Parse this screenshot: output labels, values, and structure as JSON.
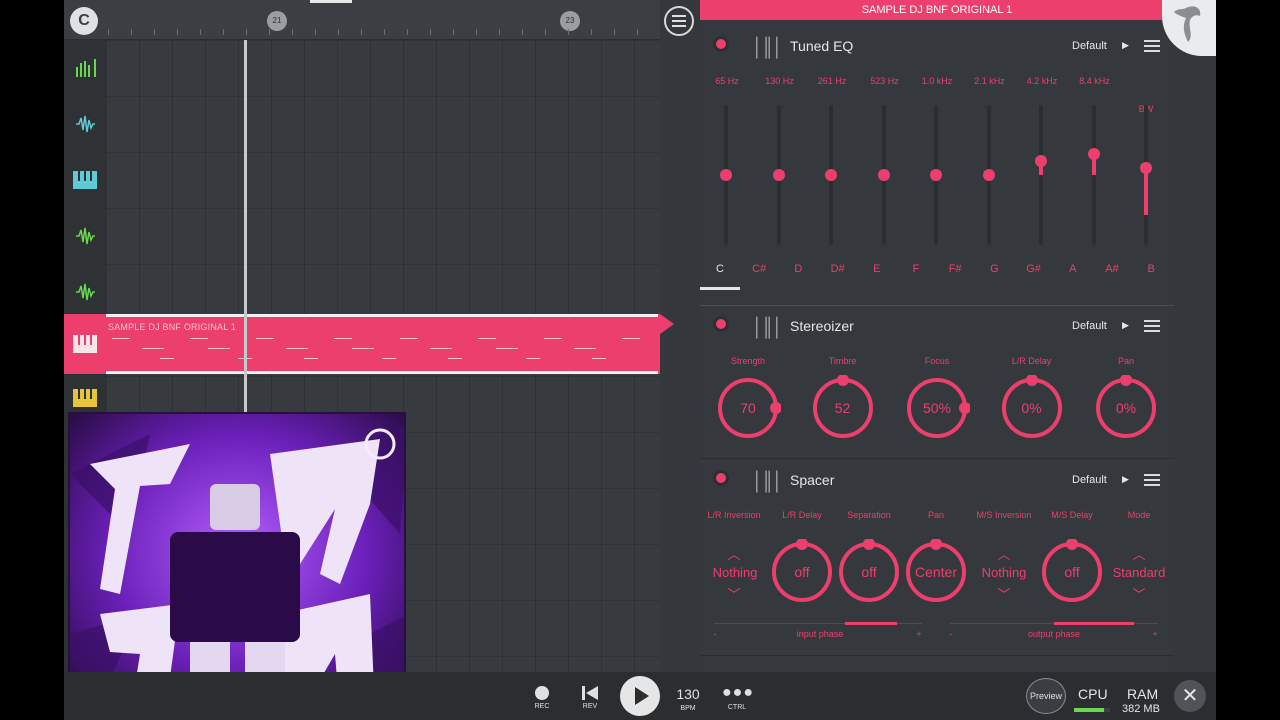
{
  "ruler": {
    "markers": [
      "21",
      "23"
    ]
  },
  "logo": "C",
  "clip": {
    "name": "SAMPLE DJ BNF ORIGINAL 1"
  },
  "mixer": {
    "channel_title": "SAMPLE DJ BNF ORIGINAL 1"
  },
  "tuned_eq": {
    "title": "Tuned EQ",
    "preset": "Default",
    "freqs": [
      "65 Hz",
      "130 Hz",
      "261 Hz",
      "523 Hz",
      "1.0 kHz",
      "2.1 kHz",
      "4.2 kHz",
      "8.4 kHz"
    ],
    "bw_label": "BW",
    "band_levels": [
      0.5,
      0.5,
      0.5,
      0.5,
      0.5,
      0.5,
      0.6,
      0.65,
      0.55
    ],
    "notes": [
      "C",
      "C#",
      "D",
      "D#",
      "E",
      "F",
      "F#",
      "G",
      "G#",
      "A",
      "A#",
      "B"
    ],
    "selected_note": "C"
  },
  "stereoizer": {
    "title": "Stereoizer",
    "preset": "Default",
    "knobs": [
      {
        "label": "Strength",
        "value": "70"
      },
      {
        "label": "Timbre",
        "value": "52"
      },
      {
        "label": "Focus",
        "value": "50%"
      },
      {
        "label": "L/R Delay",
        "value": "0%"
      },
      {
        "label": "Pan",
        "value": "0%"
      }
    ]
  },
  "spacer": {
    "title": "Spacer",
    "preset": "Default",
    "labels": [
      "L/R Inversion",
      "L/R Delay",
      "Separation",
      "Pan",
      "M/S Inversion",
      "M/S Delay",
      "Mode"
    ],
    "lr_inversion": "Nothing",
    "lr_delay": "off",
    "separation": "off",
    "pan": "Center",
    "ms_inversion": "Nothing",
    "ms_delay": "off",
    "mode": "Standard",
    "input_phase_label": "input phase",
    "output_phase_label": "output phase",
    "minus": "-",
    "plus": "+"
  },
  "transport": {
    "rec": "REC",
    "rev": "REV",
    "bpm_value": "130",
    "bpm_label": "BPM",
    "ctrl": "CTRL",
    "preview": "Preview",
    "cpu": "CPU",
    "ram": "RAM",
    "ram_value": "382 MB"
  },
  "colors": {
    "accent": "#ec3f6d",
    "background": "#35393d"
  }
}
